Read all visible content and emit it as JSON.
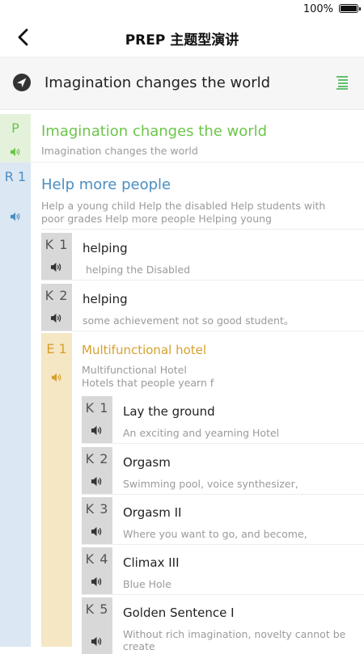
{
  "status": {
    "battery_text": "100%"
  },
  "nav": {
    "title": "PREP 主题型演讲",
    "back_icon": "chevron-left-icon"
  },
  "topic": {
    "title": "Imagination changes the world",
    "compass_icon": "compass-icon",
    "list_icon": "list-icon"
  },
  "colors": {
    "green": "#6cc54a",
    "blue": "#4a8ec2",
    "gold": "#d6a02d",
    "gray_tag": "#d8d8d8"
  },
  "point": {
    "tag": "P",
    "title": "Imagination changes the world",
    "subtitle": "Imagination changes the world"
  },
  "reason": {
    "tag": "R 1",
    "title": "Help more people",
    "subtitle": "Help a young child Help the disabled Help students with poor grades Help more people Helping young",
    "keys": [
      {
        "tag": "K 1",
        "title": "helping",
        "subtitle": " helping the Disabled"
      },
      {
        "tag": "K 2",
        "title": "helping",
        "subtitle": "some achievement not so good student。"
      }
    ],
    "example": {
      "tag": "E 1",
      "title": "Multifunctional hotel",
      "subtitle_line1": "Multifunctional Hotel",
      "subtitle_line2": "Hotels that people yearn f",
      "keys": [
        {
          "tag": "K 1",
          "title": "Lay the ground",
          "subtitle": "An exciting and yearning Hotel"
        },
        {
          "tag": "K 2",
          "title": "Orgasm",
          "subtitle": "Swimming pool, voice synthesizer,"
        },
        {
          "tag": "K 3",
          "title": "Orgasm II",
          "subtitle": "Where you want to go, and become,"
        },
        {
          "tag": "K 4",
          "title": "Climax III",
          "subtitle": "Blue Hole"
        },
        {
          "tag": "K 5",
          "title": "Golden Sentence I",
          "subtitle": "Without rich imagination, novelty cannot be create"
        }
      ]
    }
  }
}
